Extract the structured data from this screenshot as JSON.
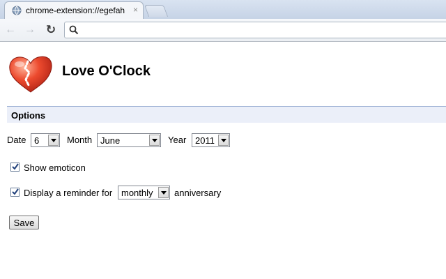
{
  "browser": {
    "tab_title": "chrome-extension://egefah",
    "tab_close": "×",
    "icons": {
      "favicon": "globe-icon",
      "back": "back-arrow-icon",
      "forward": "forward-arrow-icon",
      "reload": "reload-icon",
      "omnibox": "search-icon",
      "close": "close-icon"
    },
    "nav": {
      "back": "←",
      "forward": "→",
      "reload": "↻"
    },
    "address_value": ""
  },
  "page": {
    "logo_icon": "broken-heart-icon",
    "title": "Love O'Clock",
    "section_title": "Options",
    "date": {
      "label": "Date",
      "value": "6"
    },
    "month": {
      "label": "Month",
      "value": "June"
    },
    "year": {
      "label": "Year",
      "value": "2011"
    },
    "show_emoticon": {
      "label": "Show emoticon",
      "checked": true
    },
    "reminder": {
      "prefix": "Display a reminder for",
      "frequency": "monthly",
      "suffix": "anniversary",
      "checked": true
    },
    "save_label": "Save"
  },
  "colors": {
    "section_bg": "#ebeff9",
    "section_border": "#9cb0d4",
    "heart": "#e8402c"
  }
}
